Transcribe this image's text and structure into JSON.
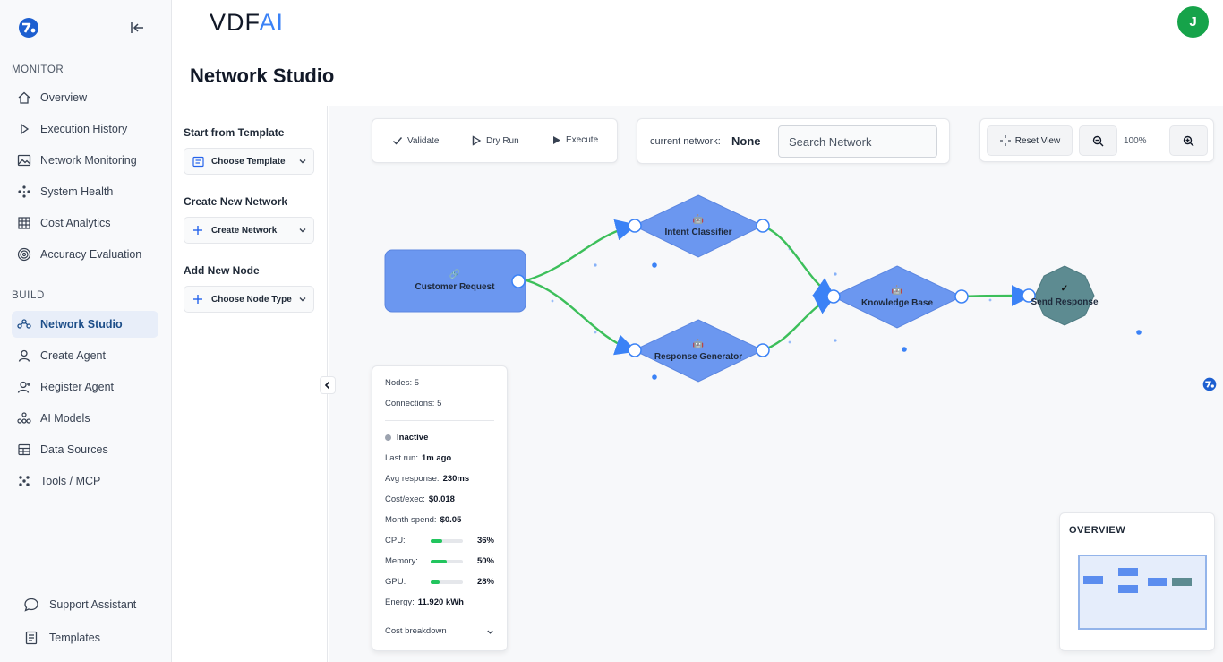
{
  "app": {
    "brand_left": "VDF",
    "brand_right": "AI",
    "avatar_initial": "J"
  },
  "page": {
    "title": "Network Studio"
  },
  "sidebar": {
    "monitor_label": "MONITOR",
    "build_label": "BUILD",
    "monitor_items": [
      {
        "label": "Overview",
        "icon": "home-icon"
      },
      {
        "label": "Execution History",
        "icon": "play-icon"
      },
      {
        "label": "Network Monitoring",
        "icon": "image-icon"
      },
      {
        "label": "System Health",
        "icon": "nodes-icon"
      },
      {
        "label": "Cost Analytics",
        "icon": "grid-icon"
      },
      {
        "label": "Accuracy Evaluation",
        "icon": "target-icon"
      }
    ],
    "build_items": [
      {
        "label": "Network Studio",
        "icon": "network-icon",
        "active": true
      },
      {
        "label": "Create Agent",
        "icon": "user-icon"
      },
      {
        "label": "Register Agent",
        "icon": "user-plus-icon"
      },
      {
        "label": "AI Models",
        "icon": "models-icon"
      },
      {
        "label": "Data Sources",
        "icon": "table-icon"
      },
      {
        "label": "Tools / MCP",
        "icon": "tools-icon"
      }
    ],
    "bottom_items": [
      {
        "label": "Support Assistant",
        "icon": "chat-icon"
      },
      {
        "label": "Templates",
        "icon": "document-icon"
      }
    ]
  },
  "left_panel": {
    "template_heading": "Start from Template",
    "template_select": "Choose Template",
    "network_heading": "Create New Network",
    "network_select": "Create Network",
    "node_heading": "Add New Node",
    "node_select": "Choose Node Type"
  },
  "toolbar": {
    "validate": "Validate",
    "dry_run": "Dry Run",
    "execute": "Execute",
    "current_network_label": "current network:",
    "current_network_value": "None",
    "search_placeholder": "Search Network",
    "reset_view": "Reset View",
    "zoom_level": "100%"
  },
  "graph": {
    "nodes": [
      {
        "id": "customer_request",
        "label": "Customer Request",
        "icon": "🔗"
      },
      {
        "id": "intent_classifier",
        "label": "Intent Classifier",
        "icon": "🤖"
      },
      {
        "id": "response_generator",
        "label": "Response Generator",
        "icon": "🤖"
      },
      {
        "id": "knowledge_base",
        "label": "Knowledge Base",
        "icon": "🤖"
      },
      {
        "id": "send_response",
        "label": "Send Response",
        "icon": "✓"
      }
    ],
    "edges": [
      [
        "customer_request",
        "intent_classifier"
      ],
      [
        "customer_request",
        "response_generator"
      ],
      [
        "intent_classifier",
        "knowledge_base"
      ],
      [
        "response_generator",
        "knowledge_base"
      ],
      [
        "knowledge_base",
        "send_response"
      ]
    ],
    "colors": {
      "node": "#6b97f0",
      "node_dark": "#5d8b91",
      "edge": "#3cbf5a"
    }
  },
  "stats": {
    "nodes_label": "Nodes:",
    "nodes_value": "5",
    "connections_label": "Connections:",
    "connections_value": "5",
    "status": "Inactive",
    "last_run_label": "Last run:",
    "last_run_value": "1m ago",
    "avg_response_label": "Avg response:",
    "avg_response_value": "230ms",
    "cost_exec_label": "Cost/exec:",
    "cost_exec_value": "$0.018",
    "month_spend_label": "Month spend:",
    "month_spend_value": "$0.05",
    "cpu_label": "CPU:",
    "cpu_value": "36%",
    "cpu_fraction": 0.36,
    "memory_label": "Memory:",
    "memory_value": "50%",
    "memory_fraction": 0.5,
    "gpu_label": "GPU:",
    "gpu_value": "28%",
    "gpu_fraction": 0.28,
    "energy_label": "Energy:",
    "energy_value": "11.920 kWh",
    "cost_breakdown": "Cost breakdown"
  },
  "overview": {
    "title": "OVERVIEW"
  }
}
